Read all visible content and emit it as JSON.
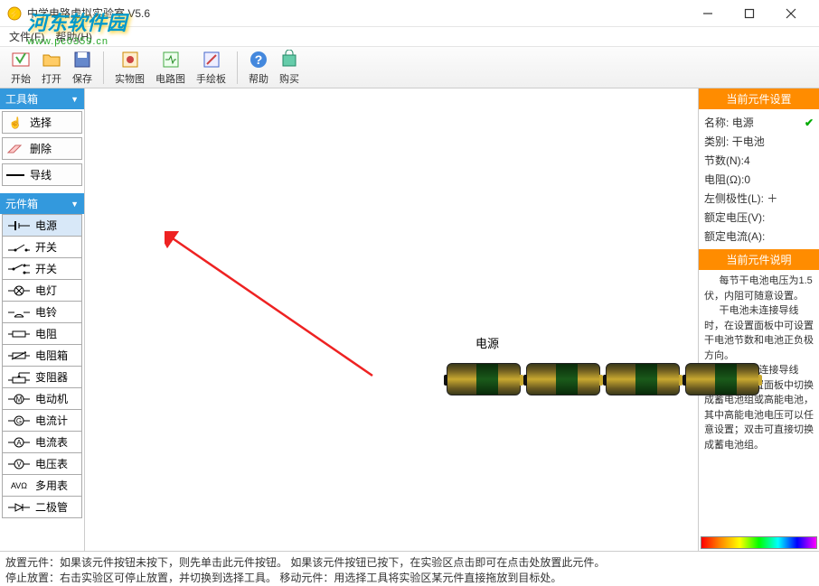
{
  "window": {
    "title": "中学电路虚拟实验室 V5.6"
  },
  "watermark": {
    "logo": "河东软件园",
    "url": "www.pc0359.cn"
  },
  "menu": {
    "file": "文件(F)",
    "help": "帮助(H)"
  },
  "toolbar": {
    "start": "开始",
    "open": "打开",
    "save": "保存",
    "real": "实物图",
    "circuit": "电路图",
    "draw": "手绘板",
    "help": "帮助",
    "buy": "购买"
  },
  "toolbox": {
    "title": "工具箱",
    "select": "选择",
    "delete": "删除",
    "wire": "导线"
  },
  "compbox": {
    "title": "元件箱",
    "items": [
      {
        "label": "电源"
      },
      {
        "label": "开关"
      },
      {
        "label": "开关"
      },
      {
        "label": "电灯"
      },
      {
        "label": "电铃"
      },
      {
        "label": "电阻"
      },
      {
        "label": "电阻箱"
      },
      {
        "label": "变阻器"
      },
      {
        "label": "电动机"
      },
      {
        "label": "电流计"
      },
      {
        "label": "电流表"
      },
      {
        "label": "电压表"
      },
      {
        "label": "多用表"
      },
      {
        "label": "二极管"
      }
    ]
  },
  "canvas": {
    "label": "电源"
  },
  "props": {
    "title": "当前元件设置",
    "name_k": "名称:",
    "name_v": "电源",
    "type_k": "类别:",
    "type_v": "干电池",
    "count_k": "节数(N):",
    "count_v": "4",
    "res_k": "电阻(Ω):",
    "res_v": "0",
    "pol_k": "左侧极性(L):",
    "pol_v": "＋",
    "volt_k": "额定电压(V):",
    "volt_v": "",
    "amp_k": "额定电流(A):",
    "amp_v": ""
  },
  "desc": {
    "title": "当前元件说明",
    "p1": "每节干电池电压为1.5伏，内阻可随意设置。",
    "p2": "干电池未连接导线时，在设置面板中可设置干电池节数和电池正负极方向。",
    "p3": "干电池未连接导线时，可在设置面板中切换成蓄电池组或高能电池，其中高能电池电压可以任意设置；双击可直接切换成蓄电池组。"
  },
  "status": {
    "line1": "放置元件：如果该元件按钮未按下，则先单击此元件按钮。 如果该元件按钮已按下，在实验区点击即可在点击处放置此元件。",
    "line2": "停止放置：右击实验区可停止放置，并切换到选择工具。 移动元件：用选择工具将实验区某元件直接拖放到目标处。"
  }
}
